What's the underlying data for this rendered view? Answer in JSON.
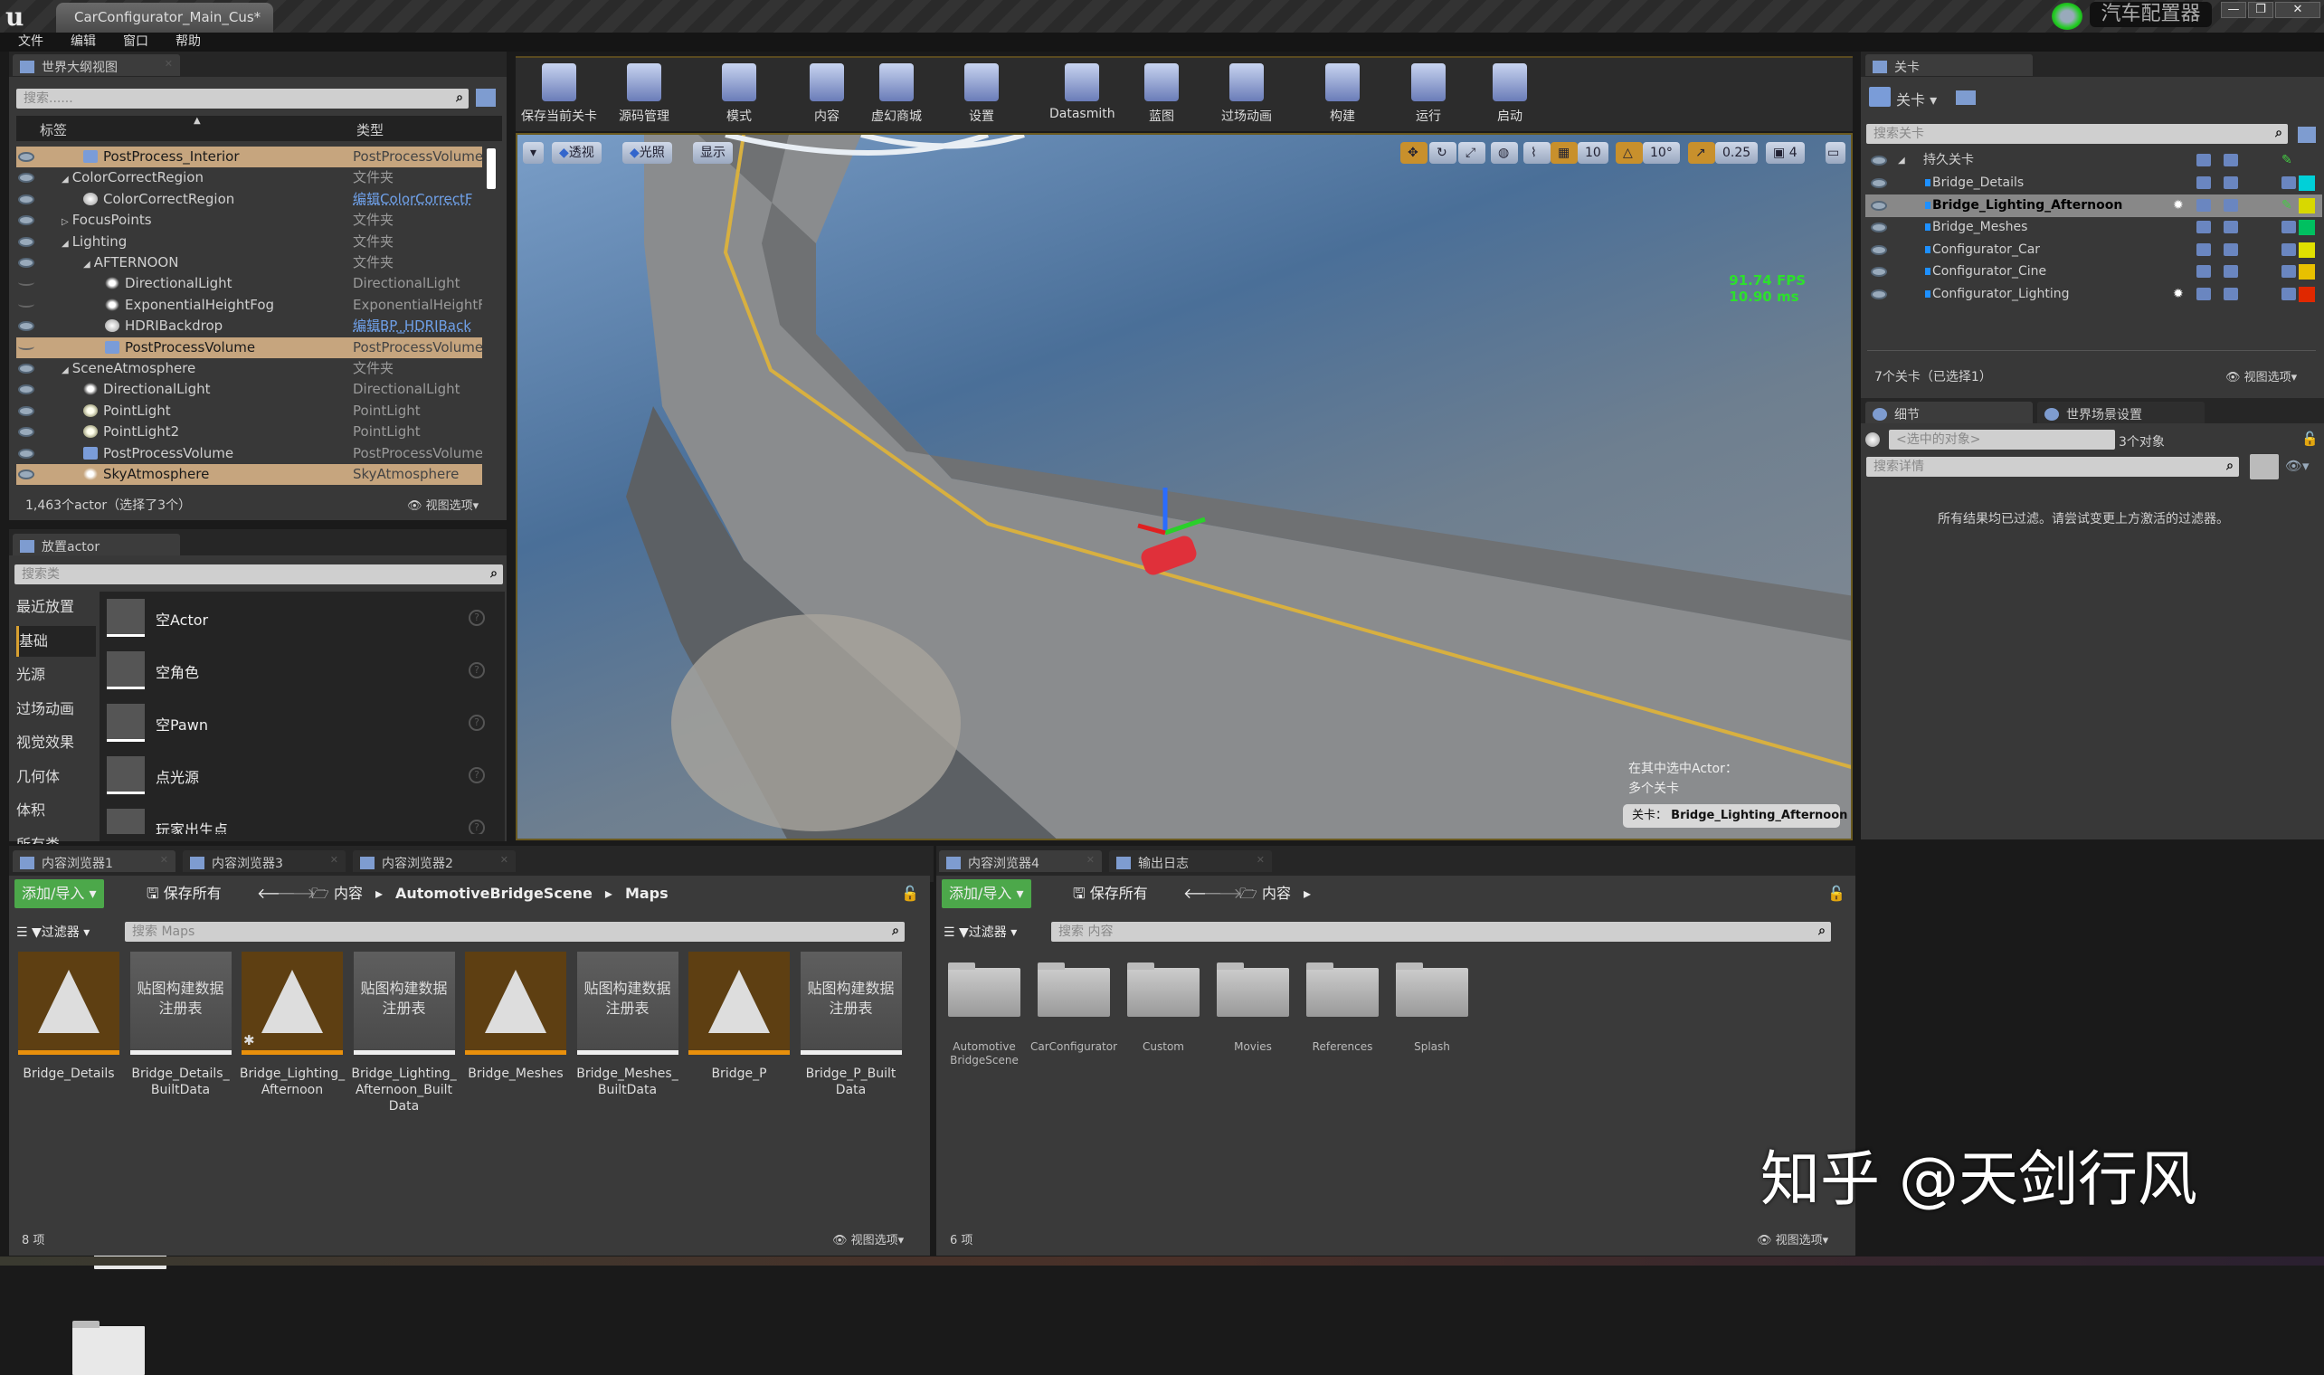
{
  "window": {
    "doc_tab": "CarConfigurator_Main_Cus*",
    "app_name": "汽车配置器",
    "minimize": "—",
    "restore": "❐",
    "close": "✕"
  },
  "menu": [
    "文件",
    "编辑",
    "窗口",
    "帮助"
  ],
  "outliner": {
    "tab": "世界大纲视图",
    "search_placeholder": "搜索......",
    "col_label": "标签",
    "col_type": "类型",
    "rows": [
      {
        "name": "PostProcess_Interior",
        "type": "PostProcessVolume",
        "depth": 2,
        "icon": "actor",
        "selected": true,
        "visible": true
      },
      {
        "name": "ColorCorrectRegion",
        "type": "文件夹",
        "depth": 1,
        "icon": "folder",
        "expand": "open",
        "visible": true
      },
      {
        "name": "ColorCorrectRegion",
        "type": "编辑ColorCorrectF",
        "depth": 2,
        "icon": "sphere",
        "link": true,
        "visible": true
      },
      {
        "name": "FocusPoints",
        "type": "文件夹",
        "depth": 1,
        "icon": "folder",
        "expand": "closed",
        "visible": true
      },
      {
        "name": "Lighting",
        "type": "文件夹",
        "depth": 1,
        "icon": "folder",
        "expand": "open",
        "visible": true
      },
      {
        "name": "AFTERNOON",
        "type": "文件夹",
        "depth": 2,
        "icon": "folder",
        "expand": "open",
        "visible": true
      },
      {
        "name": "DirectionalLight",
        "type": "DirectionalLight",
        "depth": 3,
        "icon": "sun",
        "visible": false
      },
      {
        "name": "ExponentialHeightFog",
        "type": "ExponentialHeightFc",
        "depth": 3,
        "icon": "sun",
        "visible": false
      },
      {
        "name": "HDRIBackdrop",
        "type": "编辑BP_HDRIBack",
        "depth": 3,
        "icon": "sphere",
        "link": true,
        "visible": true
      },
      {
        "name": "PostProcessVolume",
        "type": "PostProcessVolume",
        "depth": 3,
        "icon": "actor",
        "selected": true,
        "visible": false
      },
      {
        "name": "SceneAtmosphere",
        "type": "文件夹",
        "depth": 1,
        "icon": "folder",
        "expand": "open",
        "visible": true
      },
      {
        "name": "DirectionalLight",
        "type": "DirectionalLight",
        "depth": 2,
        "icon": "sun",
        "visible": true
      },
      {
        "name": "PointLight",
        "type": "PointLight",
        "depth": 2,
        "icon": "light",
        "visible": true
      },
      {
        "name": "PointLight2",
        "type": "PointLight",
        "depth": 2,
        "icon": "light",
        "visible": true
      },
      {
        "name": "PostProcessVolume",
        "type": "PostProcessVolume",
        "depth": 2,
        "icon": "actor",
        "visible": true
      },
      {
        "name": "SkyAtmosphere",
        "type": "SkyAtmosphere",
        "depth": 2,
        "icon": "sun",
        "selected": true,
        "visible": true
      }
    ],
    "footer": "1,463个actor（选择了3个）",
    "view_options": "视图选项▾"
  },
  "place_actor": {
    "tab": "放置actor",
    "search_placeholder": "搜索类",
    "categories": [
      "最近放置",
      "基础",
      "光源",
      "过场动画",
      "视觉效果",
      "几何体",
      "体积",
      "所有类"
    ],
    "active_category": "基础",
    "items": [
      "空Actor",
      "空角色",
      "空Pawn",
      "点光源",
      "玩家出生点"
    ]
  },
  "toolbar": [
    {
      "label": "保存当前关卡",
      "icon": "save-icon"
    },
    {
      "label": "源码管理",
      "icon": "source-control-icon"
    },
    {
      "label": "模式",
      "icon": "modes-icon"
    },
    {
      "label": "内容",
      "icon": "content-icon"
    },
    {
      "label": "虚幻商城",
      "icon": "marketplace-icon"
    },
    {
      "label": "设置",
      "icon": "settings-icon"
    },
    {
      "label": "Datasmith",
      "icon": "datasmith-icon"
    },
    {
      "label": "蓝图",
      "icon": "blueprint-icon"
    },
    {
      "label": "过场动画",
      "icon": "cinematics-icon"
    },
    {
      "label": "构建",
      "icon": "build-icon"
    },
    {
      "label": "运行",
      "icon": "play-icon"
    },
    {
      "label": "启动",
      "icon": "launch-icon"
    }
  ],
  "viewport": {
    "perspective": "透视",
    "lighting": "光照",
    "show": "显示",
    "grid_snap": "10",
    "rotation_snap": "10°",
    "scale_snap": "0.25",
    "camera_speed": "4",
    "fps": "91.74 FPS",
    "frame_ms": "10.90 ms",
    "selection_info_1": "在其中选中Actor：",
    "selection_info_2": "多个关卡",
    "current_level_label": "关卡：",
    "current_level": "Bridge_Lighting_Afternoon"
  },
  "levels": {
    "tab": "关卡",
    "dropdown": "关卡 ▾",
    "search_placeholder": "搜索关卡",
    "persistent": "持久关卡",
    "rows": [
      {
        "name": "Bridge_Details",
        "color": "#00d0d8"
      },
      {
        "name": "Bridge_Lighting_Afternoon",
        "color": "#d8d800",
        "selected": true,
        "lighting": true
      },
      {
        "name": "Bridge_Meshes",
        "color": "#00c060"
      },
      {
        "name": "Configurator_Car",
        "color": "#e0e000"
      },
      {
        "name": "Configurator_Cine",
        "color": "#e8c000"
      },
      {
        "name": "Configurator_Lighting",
        "color": "#e02800",
        "lighting": true
      }
    ],
    "footer": "7个关卡（已选择1）",
    "view_options": "视图选项▾"
  },
  "details": {
    "tab_details": "细节",
    "tab_world": "世界场景设置",
    "selected_placeholder": "<选中的对象>",
    "object_count": "3个对象",
    "search_placeholder": "搜索详情",
    "message": "所有结果均已过滤。请尝试变更上方激活的过滤器。"
  },
  "content_left": {
    "tabs": [
      "内容浏览器1",
      "内容浏览器3",
      "内容浏览器2"
    ],
    "add_import": "添加/导入 ▾",
    "save_all": "保存所有",
    "path": [
      "内容",
      "AutomotiveBridgeScene",
      "Maps"
    ],
    "filters": "过滤器 ▾",
    "search_placeholder": "搜索 Maps",
    "assets": [
      {
        "name": "Bridge_Details",
        "kind": "map"
      },
      {
        "name": "Bridge_Details_ BuiltData",
        "kind": "data"
      },
      {
        "name": "Bridge_Lighting_ Afternoon",
        "kind": "map"
      },
      {
        "name": "Bridge_Lighting_ Afternoon_Built Data",
        "kind": "data"
      },
      {
        "name": "Bridge_Meshes",
        "kind": "map"
      },
      {
        "name": "Bridge_Meshes_ BuiltData",
        "kind": "data"
      },
      {
        "name": "Bridge_P",
        "kind": "map"
      },
      {
        "name": "Bridge_P_Built Data",
        "kind": "data"
      }
    ],
    "data_thumb_text": "贴图构建数据 注册表",
    "count": "8 项",
    "view_options": "视图选项▾"
  },
  "content_right": {
    "tabs": [
      "内容浏览器4",
      "输出日志"
    ],
    "add_import": "添加/导入 ▾",
    "save_all": "保存所有",
    "path": [
      "内容"
    ],
    "filters": "过滤器 ▾",
    "search_placeholder": "搜索 内容",
    "folders": [
      "Automotive BridgeScene",
      "CarConfigurator",
      "Custom",
      "Movies",
      "References",
      "Splash"
    ],
    "count": "6 项",
    "view_options": "视图选项▾"
  },
  "watermark": "知乎 @天剑行风"
}
